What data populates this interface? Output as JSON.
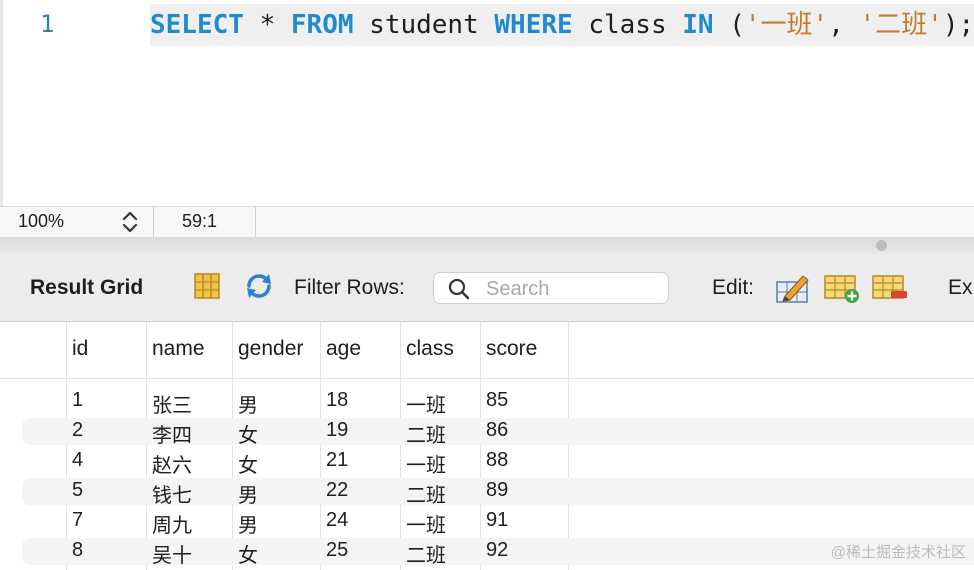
{
  "editor": {
    "line_number": "1",
    "tokens": [
      {
        "text": "SELECT",
        "type": "kw"
      },
      {
        "text": " * ",
        "type": "plain"
      },
      {
        "text": "FROM",
        "type": "kw"
      },
      {
        "text": " student ",
        "type": "plain"
      },
      {
        "text": "WHERE",
        "type": "kw"
      },
      {
        "text": " class ",
        "type": "plain"
      },
      {
        "text": "IN",
        "type": "kw"
      },
      {
        "text": " (",
        "type": "plain"
      },
      {
        "text": "'一班'",
        "type": "str"
      },
      {
        "text": ", ",
        "type": "plain"
      },
      {
        "text": "'二班'",
        "type": "str"
      },
      {
        "text": ");",
        "type": "plain"
      }
    ]
  },
  "statusbar": {
    "zoom": "100%",
    "cursor": "59:1"
  },
  "toolbar": {
    "result_grid_label": "Result Grid",
    "filter_rows_label": "Filter Rows:",
    "search_placeholder": "Search",
    "search_value": "",
    "edit_label": "Edit:",
    "export_label": "Ex"
  },
  "grid": {
    "columns": [
      "id",
      "name",
      "gender",
      "age",
      "class",
      "score"
    ],
    "rows": [
      [
        "1",
        "张三",
        "男",
        "18",
        "一班",
        "85"
      ],
      [
        "2",
        "李四",
        "女",
        "19",
        "二班",
        "86"
      ],
      [
        "4",
        "赵六",
        "女",
        "21",
        "一班",
        "88"
      ],
      [
        "5",
        "钱七",
        "男",
        "22",
        "二班",
        "89"
      ],
      [
        "7",
        "周九",
        "男",
        "24",
        "一班",
        "91"
      ],
      [
        "8",
        "吴十",
        "女",
        "25",
        "二班",
        "92"
      ]
    ]
  },
  "watermark": "@稀土掘金技术社区",
  "colors": {
    "keyword": "#1f8ad0",
    "string": "#c17d2e",
    "line_number": "#2d7ea8",
    "toolbar_bg": "#ececec"
  },
  "icons": [
    "chevron-up-down-icon",
    "form-view-icon",
    "refresh-icon",
    "search-icon",
    "edit-cell-icon",
    "add-row-icon",
    "delete-row-icon"
  ]
}
